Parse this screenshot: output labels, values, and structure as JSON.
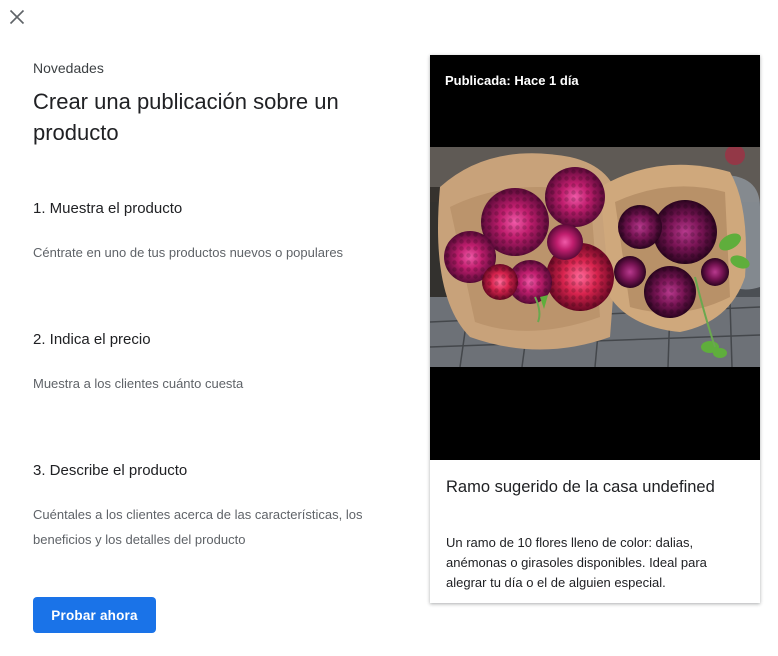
{
  "header": {
    "close_icon": "close-icon"
  },
  "intro": {
    "eyebrow": "Novedades",
    "title": "Crear una publicación sobre un producto"
  },
  "steps": [
    {
      "title": "1. Muestra el producto",
      "description": "Céntrate en uno de tus productos nuevos o populares"
    },
    {
      "title": "2. Indica el precio",
      "description": "Muestra a los clientes cuánto cuesta"
    },
    {
      "title": "3. Describe el producto",
      "description": "Cuéntales a los clientes acerca de las características, los beneficios y los detalles del producto"
    }
  ],
  "cta": {
    "label": "Probar ahora",
    "color": "#1a73e8"
  },
  "preview": {
    "posted": "Publicada: Hace 1 día",
    "image_icon": "flower-bouquet-photo",
    "title": "Ramo sugerido de la casa undefined",
    "description": "Un ramo de 10 flores lleno de color: dalias, anémonas o girasoles disponibles. Ideal para alegrar tu día o el de alguien especial."
  }
}
